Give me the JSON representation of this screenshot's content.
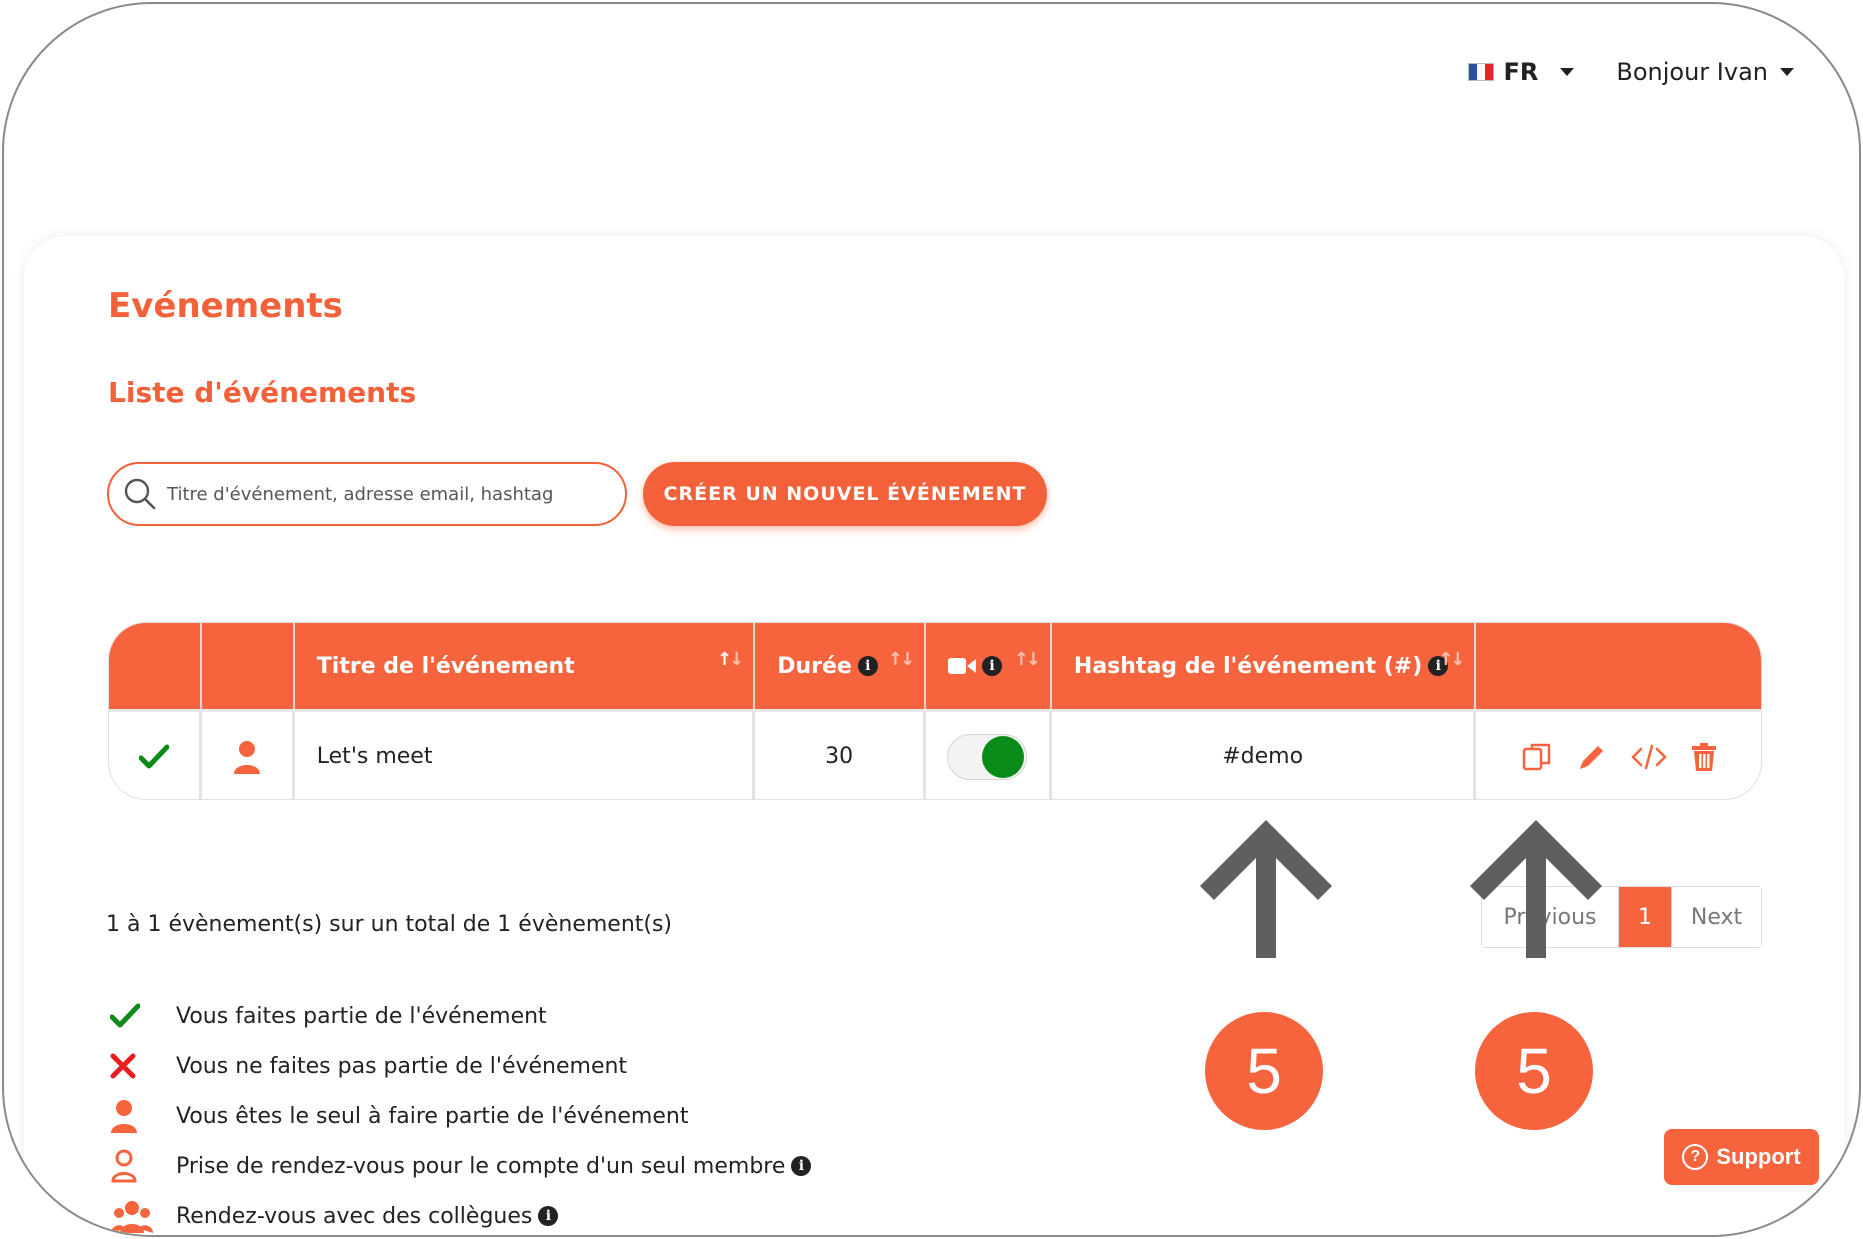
{
  "header": {
    "language": "FR",
    "greeting": "Bonjour Ivan"
  },
  "page": {
    "title": "Evénements",
    "subtitle": "Liste d'événements"
  },
  "search": {
    "placeholder": "Titre d'événement, adresse email, hashtag",
    "value": ""
  },
  "toolbar": {
    "create_label": "CRÉER UN NOUVEL ÉVÉNEMENT"
  },
  "table": {
    "columns": [
      "",
      "",
      "Titre de l'événement",
      "Durée",
      "",
      "Hashtag de l'événement (#)",
      ""
    ],
    "rows": [
      {
        "status_icon": "check-icon",
        "type_icon": "single-user-icon",
        "title": "Let's meet",
        "duration": "30",
        "video_enabled": true,
        "hashtag": "#demo",
        "actions": [
          "duplicate-icon",
          "edit-icon",
          "embed-code-icon",
          "delete-icon"
        ]
      }
    ]
  },
  "summary": "1 à 1 évènement(s) sur un total de 1 évènement(s)",
  "pagination": {
    "previous": "Previous",
    "current": "1",
    "next": "Next"
  },
  "legend": [
    {
      "icon": "check-icon",
      "label": "Vous faites partie de l'événement"
    },
    {
      "icon": "cross-icon",
      "label": "Vous ne faites pas partie de l'événement"
    },
    {
      "icon": "single-user-icon",
      "label": "Vous êtes le seul à faire partie de l'événement"
    },
    {
      "icon": "user-outline-icon",
      "label": "Prise de rendez-vous pour le compte d'un seul membre"
    },
    {
      "icon": "group-icon",
      "label": "Rendez-vous avec des collègues"
    }
  ],
  "annotations": {
    "badge_left": "5",
    "badge_right": "5"
  },
  "support": {
    "label": "Support"
  },
  "colors": {
    "accent": "#f5643d",
    "success": "#0a8a16",
    "danger": "#e61e1e"
  }
}
